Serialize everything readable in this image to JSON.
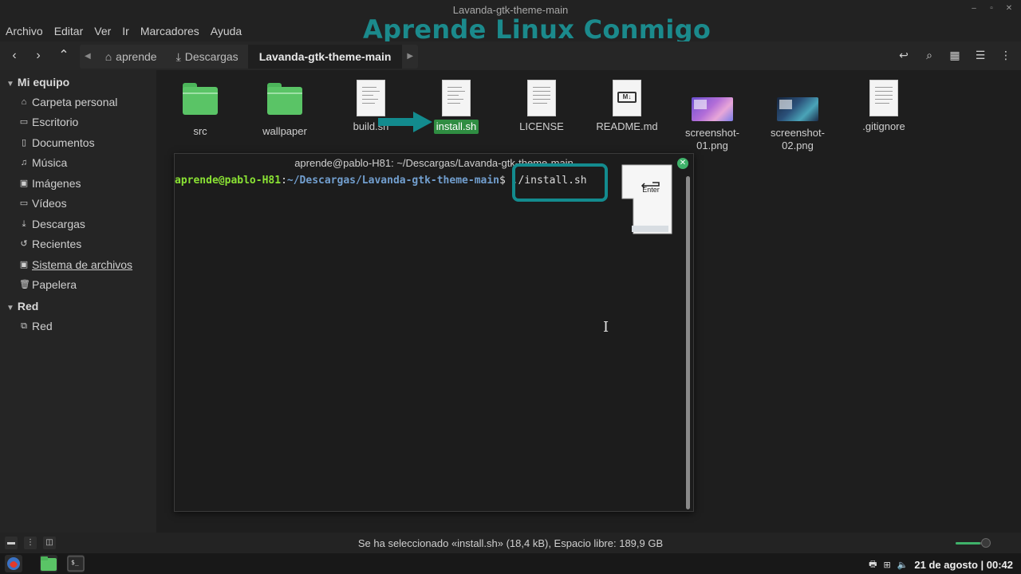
{
  "window": {
    "title": "Lavanda-gtk-theme-main"
  },
  "watermark": "Aprende Linux Conmigo",
  "menu": [
    "Archivo",
    "Editar",
    "Ver",
    "Ir",
    "Marcadores",
    "Ayuda"
  ],
  "breadcrumbs": [
    {
      "label": "aprende",
      "icon": "home-icon"
    },
    {
      "label": "Descargas",
      "icon": "download-icon"
    },
    {
      "label": "Lavanda-gtk-theme-main",
      "icon": ""
    }
  ],
  "sidebar": {
    "sections": [
      {
        "title": "Mi equipo",
        "items": [
          {
            "label": "Carpeta personal",
            "icon": "home-icon"
          },
          {
            "label": "Escritorio",
            "icon": "folder-icon"
          },
          {
            "label": "Documentos",
            "icon": "document-icon"
          },
          {
            "label": "Música",
            "icon": "music-icon"
          },
          {
            "label": "Imágenes",
            "icon": "image-icon"
          },
          {
            "label": "Vídeos",
            "icon": "video-icon"
          },
          {
            "label": "Descargas",
            "icon": "download-icon"
          },
          {
            "label": "Recientes",
            "icon": "recent-icon"
          },
          {
            "label": "Sistema de archivos",
            "icon": "drive-icon"
          },
          {
            "label": "Papelera",
            "icon": "trash-icon"
          }
        ]
      },
      {
        "title": "Red",
        "items": [
          {
            "label": "Red",
            "icon": "network-icon"
          }
        ]
      }
    ]
  },
  "files": [
    {
      "name": "src",
      "type": "folder"
    },
    {
      "name": "wallpaper",
      "type": "folder"
    },
    {
      "name": "build.sh",
      "type": "script"
    },
    {
      "name": "install.sh",
      "type": "script",
      "selected": true
    },
    {
      "name": "LICENSE",
      "type": "text"
    },
    {
      "name": "README.md",
      "type": "markdown"
    },
    {
      "name": "screenshot-01.png",
      "type": "image"
    },
    {
      "name": "screenshot-02.png",
      "type": "image"
    },
    {
      "name": ".gitignore",
      "type": "text"
    }
  ],
  "terminal": {
    "title": "aprende@pablo-H81: ~/Descargas/Lavanda-gtk-theme-main",
    "prompt_user": "aprende@pablo-H81",
    "prompt_path": "~/Descargas/Lavanda-gtk-theme-main",
    "prompt_symbol": "$",
    "command": " ./install.sh",
    "enter_key_label": "Enter"
  },
  "status": "Se ha seleccionado «install.sh» (18,4 kB), Espacio libre: 189,9 GB",
  "zoom": 0.7,
  "taskbar": {
    "clock": "21 de agosto | 00:42"
  },
  "colors": {
    "accent": "#3fb26a",
    "watermark": "#1b8a8c",
    "highlight_box": "#138b8e"
  }
}
